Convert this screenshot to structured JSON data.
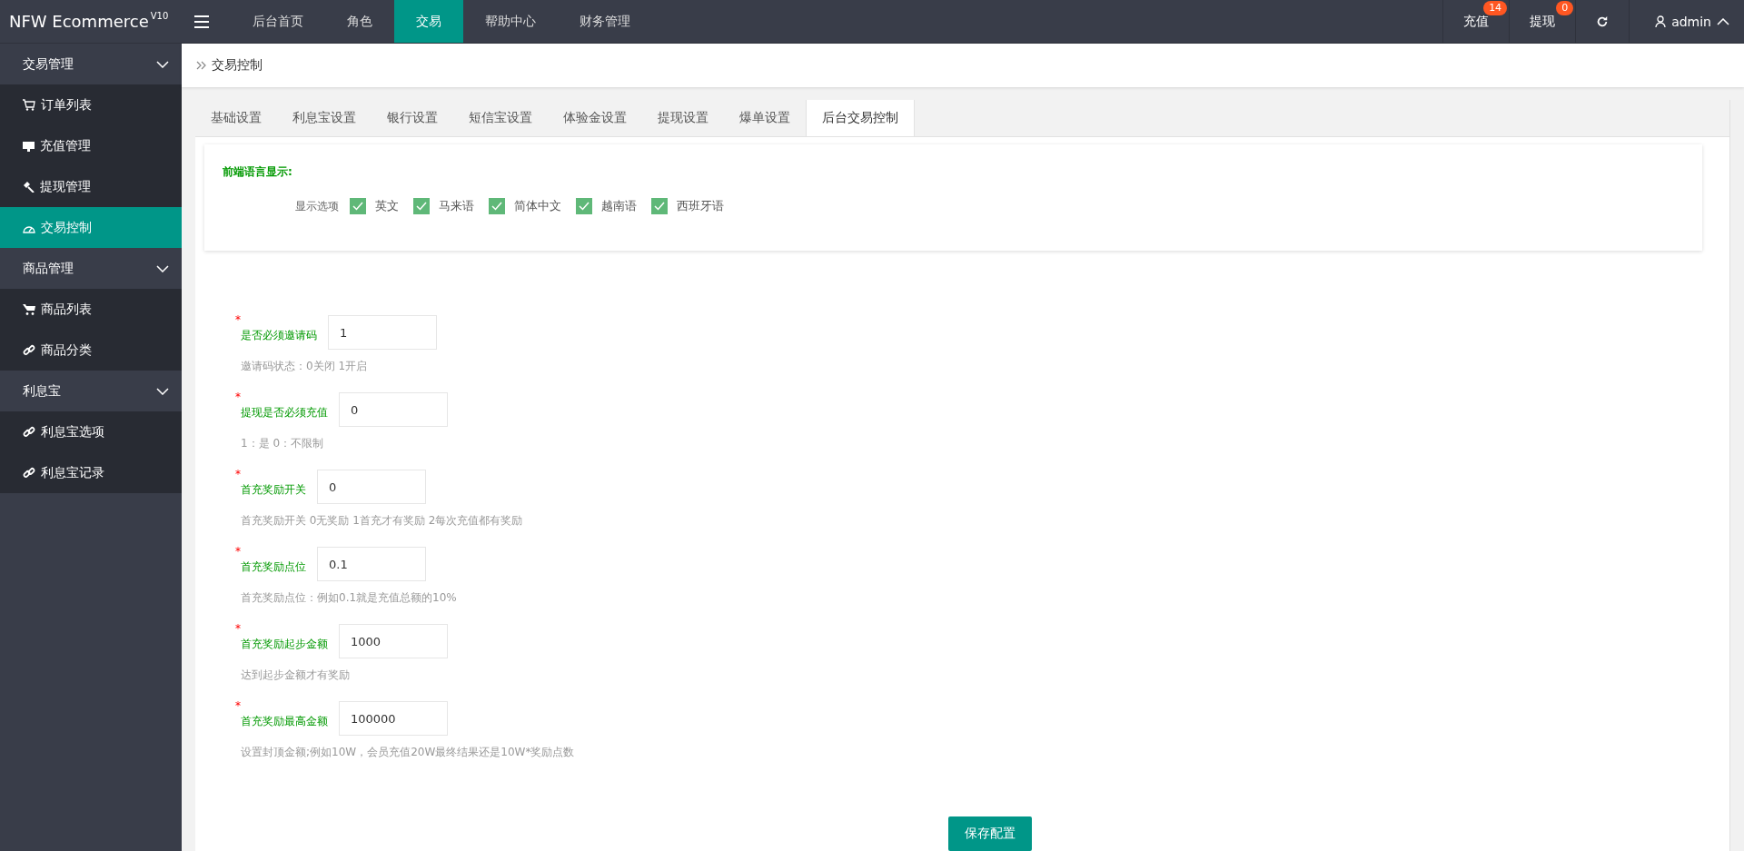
{
  "topbar": {
    "logo": "NFW Ecommerce",
    "version": "V10",
    "nav": [
      {
        "label": "后台首页",
        "selected": false
      },
      {
        "label": "角色",
        "selected": false
      },
      {
        "label": "交易",
        "selected": true
      },
      {
        "label": "帮助中心",
        "selected": false
      },
      {
        "label": "财务管理",
        "selected": false
      }
    ],
    "actions": [
      {
        "label": "充值",
        "badge": "14"
      },
      {
        "label": "提现",
        "badge": "0"
      }
    ],
    "user": "admin"
  },
  "sidebar": [
    {
      "label": "交易管理",
      "expanded": true,
      "items": [
        {
          "label": "订单列表",
          "selected": false
        },
        {
          "label": "充值管理",
          "selected": false
        },
        {
          "label": "提现管理",
          "selected": false
        },
        {
          "label": "交易控制",
          "selected": true
        }
      ]
    },
    {
      "label": "商品管理",
      "expanded": true,
      "items": [
        {
          "label": "商品列表",
          "selected": false
        },
        {
          "label": "商品分类",
          "selected": false
        }
      ]
    },
    {
      "label": "利息宝",
      "expanded": true,
      "items": [
        {
          "label": "利息宝选项",
          "selected": false
        },
        {
          "label": "利息宝记录",
          "selected": false
        }
      ]
    }
  ],
  "breadcrumb": "交易控制",
  "tabs": [
    {
      "label": "基础设置",
      "selected": false
    },
    {
      "label": "利息宝设置",
      "selected": false
    },
    {
      "label": "银行设置",
      "selected": false
    },
    {
      "label": "短信宝设置",
      "selected": false
    },
    {
      "label": "体验金设置",
      "selected": false
    },
    {
      "label": "提现设置",
      "selected": false
    },
    {
      "label": "爆单设置",
      "selected": false
    },
    {
      "label": "后台交易控制",
      "selected": true
    }
  ],
  "language": {
    "title": "前端语言显示:",
    "option_label": "显示选项",
    "options": [
      {
        "label": "英文",
        "checked": true
      },
      {
        "label": "马来语",
        "checked": true
      },
      {
        "label": "简体中文",
        "checked": true
      },
      {
        "label": "越南语",
        "checked": true
      },
      {
        "label": "西班牙语",
        "checked": true
      }
    ]
  },
  "fields": [
    {
      "label": "是否必须邀请码",
      "required_mark": "*",
      "value": "1",
      "hint": "邀请码状态：0关闭 1开启"
    },
    {
      "label": "提现是否必须充值",
      "required_mark": "*",
      "value": "0",
      "hint": "1：是 0：不限制"
    },
    {
      "label": "首充奖励开关",
      "required_mark": "*",
      "value": "0",
      "hint": "首充奖励开关 0无奖励 1首充才有奖励 2每次充值都有奖励"
    },
    {
      "label": "首充奖励点位",
      "required_mark": "*",
      "value": "0.1",
      "hint": "首充奖励点位：例如0.1就是充值总额的10%"
    },
    {
      "label": "首充奖励起步金额",
      "required_mark": "*",
      "value": "1000",
      "hint": "达到起步金额才有奖励"
    },
    {
      "label": "首充奖励最高金额",
      "required_mark": "*",
      "value": "100000",
      "hint": "设置封顶金额;例如10W，会员充值20W最终结果还是10W*奖励点数"
    }
  ],
  "save_button": "保存配置"
}
